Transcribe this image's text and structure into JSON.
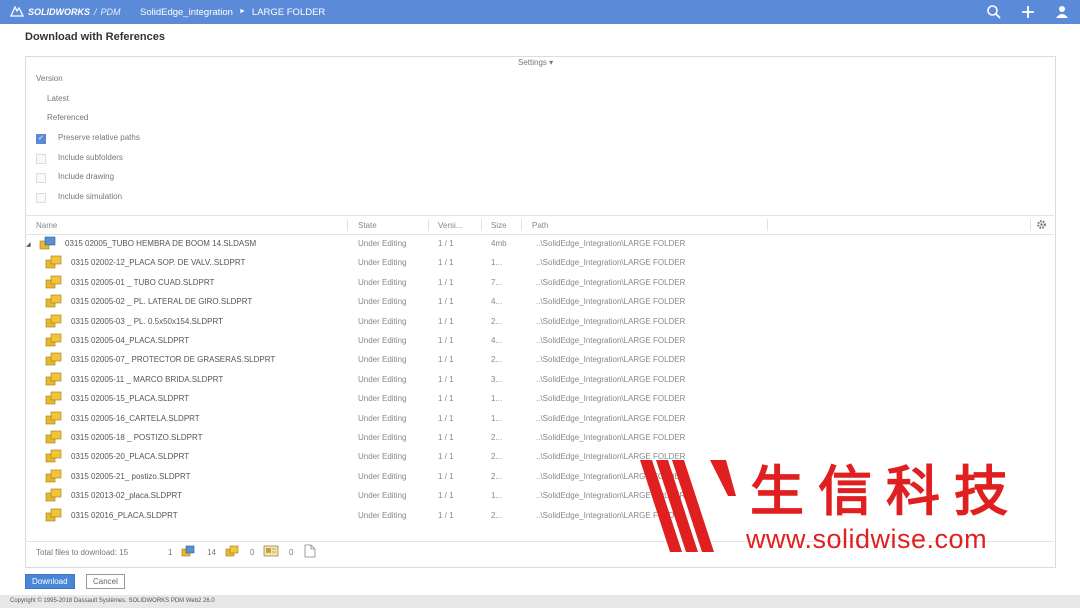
{
  "topbar": {
    "brand": "SOLIDWORKS",
    "product": "PDM",
    "separator": "/",
    "crumbs": [
      "SolidEdge_integration",
      "LARGE FOLDER"
    ],
    "crumb_sep": "►",
    "icons": [
      "search-icon",
      "plus-icon",
      "user-icon"
    ]
  },
  "dialog": {
    "title": "Download with References",
    "settings": "Settings ▾"
  },
  "options": {
    "version_label": "Version",
    "latest": "Latest",
    "referenced": "Referenced",
    "checks": [
      {
        "label": "Preserve relative paths",
        "checked": true
      },
      {
        "label": "Include subfolders",
        "checked": false
      },
      {
        "label": "Include drawing",
        "checked": false
      },
      {
        "label": "Include simulation",
        "checked": false
      }
    ]
  },
  "table": {
    "columns": [
      "Name",
      "State",
      "Versi...",
      "Size",
      "Path"
    ],
    "rows": [
      {
        "name": "0315 02005_TUBO HEMBRA DE BOOM 14.SLDASM",
        "state": "Under Editing",
        "ver": "1 / 1",
        "size": "4mb",
        "path": "..\\SolidEdge_Integration\\LARGE FOLDER",
        "icon": "assembly-icon",
        "indent": 0
      },
      {
        "name": "0315 02002-12_PLACA SOP. DE VALV..SLDPRT",
        "state": "Under Editing",
        "ver": "1 / 1",
        "size": "1...",
        "path": "..\\SolidEdge_Integration\\LARGE FOLDER",
        "icon": "part-icon",
        "indent": 1
      },
      {
        "name": "0315 02005-01 _ TUBO CUAD.SLDPRT",
        "state": "Under Editing",
        "ver": "1 / 1",
        "size": "7...",
        "path": "..\\SolidEdge_Integration\\LARGE FOLDER",
        "icon": "part-icon",
        "indent": 1
      },
      {
        "name": "0315 02005-02 _ PL. LATERAL DE GIRO.SLDPRT",
        "state": "Under Editing",
        "ver": "1 / 1",
        "size": "4...",
        "path": "..\\SolidEdge_Integration\\LARGE FOLDER",
        "icon": "part-icon",
        "indent": 1
      },
      {
        "name": "0315 02005-03 _ PL. 0.5x50x154.SLDPRT",
        "state": "Under Editing",
        "ver": "1 / 1",
        "size": "2...",
        "path": "..\\SolidEdge_Integration\\LARGE FOLDER",
        "icon": "part-icon",
        "indent": 1
      },
      {
        "name": "0315 02005-04_PLACA.SLDPRT",
        "state": "Under Editing",
        "ver": "1 / 1",
        "size": "4...",
        "path": "..\\SolidEdge_Integration\\LARGE FOLDER",
        "icon": "part-icon",
        "indent": 1
      },
      {
        "name": "0315 02005-07_ PROTECTOR DE GRASERAS.SLDPRT",
        "state": "Under Editing",
        "ver": "1 / 1",
        "size": "2...",
        "path": "..\\SolidEdge_Integration\\LARGE FOLDER",
        "icon": "part-icon",
        "indent": 1
      },
      {
        "name": "0315 02005-11 _ MARCO BRIDA.SLDPRT",
        "state": "Under Editing",
        "ver": "1 / 1",
        "size": "3...",
        "path": "..\\SolidEdge_Integration\\LARGE FOLDER",
        "icon": "part-icon",
        "indent": 1
      },
      {
        "name": "0315 02005-15_PLACA.SLDPRT",
        "state": "Under Editing",
        "ver": "1 / 1",
        "size": "1...",
        "path": "..\\SolidEdge_Integration\\LARGE FOLDER",
        "icon": "part-icon",
        "indent": 1
      },
      {
        "name": "0315 02005-16_CARTELA.SLDPRT",
        "state": "Under Editing",
        "ver": "1 / 1",
        "size": "1...",
        "path": "..\\SolidEdge_Integration\\LARGE FOLDER",
        "icon": "part-icon",
        "indent": 1
      },
      {
        "name": "0315 02005-18 _ POSTIZO.SLDPRT",
        "state": "Under Editing",
        "ver": "1 / 1",
        "size": "2...",
        "path": "..\\SolidEdge_Integration\\LARGE FOLDER",
        "icon": "part-icon",
        "indent": 1
      },
      {
        "name": "0315 02005-20_PLACA.SLDPRT",
        "state": "Under Editing",
        "ver": "1 / 1",
        "size": "2...",
        "path": "..\\SolidEdge_Integration\\LARGE FOLDER",
        "icon": "part-icon",
        "indent": 1
      },
      {
        "name": "0315 02005-21_ postizo.SLDPRT",
        "state": "Under Editing",
        "ver": "1 / 1",
        "size": "2...",
        "path": "..\\SolidEdge_Integration\\LARGE FOLDER",
        "icon": "part-icon",
        "indent": 1
      },
      {
        "name": "0315 02013-02_placa.SLDPRT",
        "state": "Under Editing",
        "ver": "1 / 1",
        "size": "1...",
        "path": "..\\SolidEdge_Integration\\LARGE FOLDER",
        "icon": "part-icon",
        "indent": 1
      },
      {
        "name": "0315 02016_PLACA.SLDPRT",
        "state": "Under Editing",
        "ver": "1 / 1",
        "size": "2...",
        "path": "..\\SolidEdge_Integration\\LARGE FOLDER",
        "icon": "part-icon",
        "indent": 1
      }
    ]
  },
  "footer": {
    "total_label": "Total files to download: 15",
    "assemblies": "1",
    "parts": "14",
    "drawings": "0",
    "other": "0"
  },
  "buttons": {
    "download": "Download",
    "cancel": "Cancel"
  },
  "copyright": "Copyright © 1995-2018 Dassault Systèmes. SOLIDWORKS PDM Web2 26.0",
  "watermark": {
    "cn": "生信科技",
    "url": "www.solidwise.com",
    "color": "#e02020"
  }
}
